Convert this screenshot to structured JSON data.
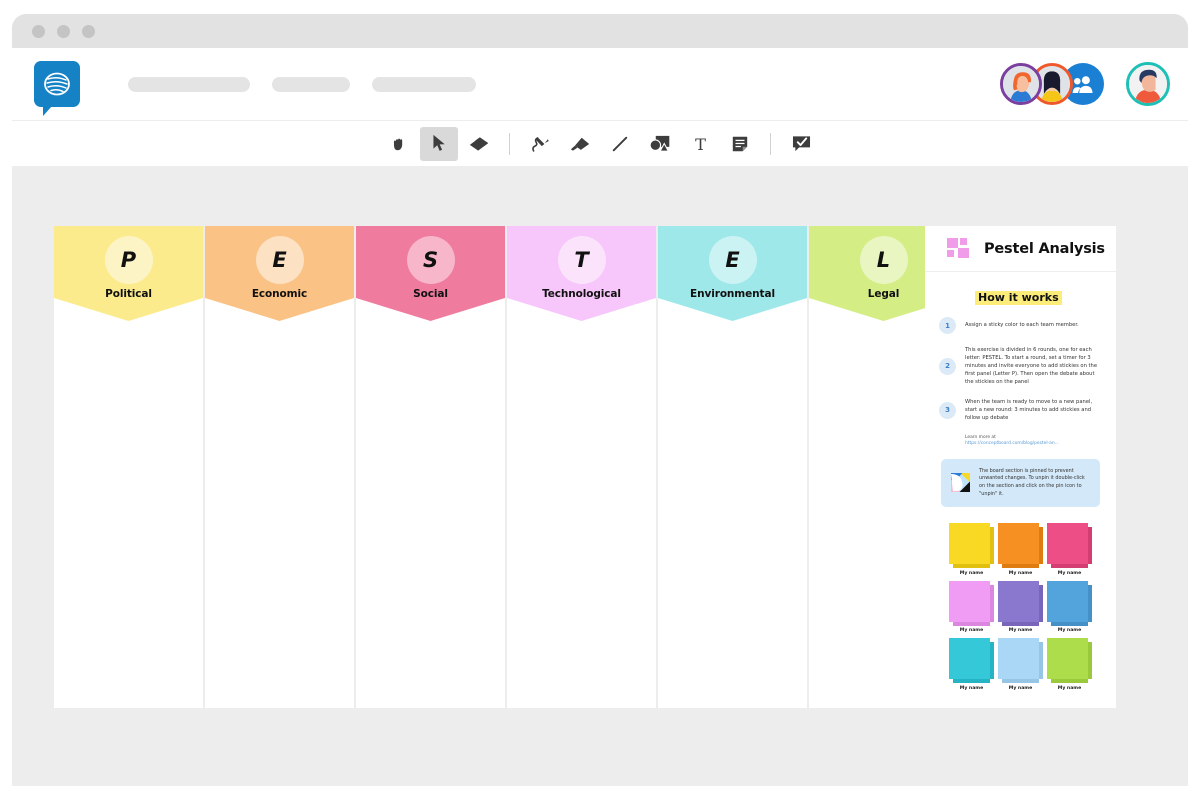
{
  "window": {
    "traffic_lights": [
      "close",
      "minimize",
      "maximize"
    ]
  },
  "header": {
    "logo_icon": "conceptboard-speech-bubble-logo",
    "nav_placeholders": [
      "",
      "",
      ""
    ],
    "collaborators": [
      {
        "name": "collaborator-1",
        "ring_color": "#7b3fa0",
        "hair": "#f0662c",
        "shirt": "#2b7bd4",
        "skin": "#f5b392"
      },
      {
        "name": "collaborator-2",
        "ring_color": "#f0582c",
        "hair": "#1a1a2e",
        "shirt": "#f5c518",
        "skin": "#f5c6a5"
      }
    ],
    "add_people": {
      "icon": "add-people-icon",
      "background": "#1b7fd4"
    },
    "current_user": {
      "ring_color": "#1dbfb6",
      "hair": "#273a63",
      "shirt": "#f05a3c",
      "skin": "#f2b79a"
    }
  },
  "toolbar": {
    "tools": [
      {
        "id": "hand",
        "icon": "hand-icon",
        "label": "Pan",
        "active": false
      },
      {
        "id": "select",
        "icon": "cursor-icon",
        "label": "Select",
        "active": true
      },
      {
        "id": "eraser",
        "icon": "eraser-icon",
        "label": "Eraser",
        "active": false
      },
      {
        "id": "pen",
        "icon": "pen-icon",
        "label": "Pen",
        "active": false
      },
      {
        "id": "marker",
        "icon": "marker-icon",
        "label": "Marker",
        "active": false
      },
      {
        "id": "line",
        "icon": "line-icon",
        "label": "Line",
        "active": false
      },
      {
        "id": "shapes",
        "icon": "shapes-icon",
        "label": "Shapes",
        "active": false
      },
      {
        "id": "text",
        "icon": "text-icon",
        "label": "Text",
        "active": false
      },
      {
        "id": "note",
        "icon": "sticky-note-icon",
        "label": "Note",
        "active": false
      },
      {
        "id": "comment",
        "icon": "comment-icon",
        "label": "Comment",
        "active": false
      }
    ]
  },
  "board": {
    "columns": [
      {
        "letter": "P",
        "label": "Political",
        "banner_color": "#fbeb8c",
        "circle_color": "#fdf4c5"
      },
      {
        "letter": "E",
        "label": "Economic",
        "banner_color": "#fac284",
        "circle_color": "#fde1c3"
      },
      {
        "letter": "S",
        "label": "Social",
        "banner_color": "#ef7b9f",
        "circle_color": "#f8b6cb"
      },
      {
        "letter": "T",
        "label": "Technological",
        "banner_color": "#f7c6fb",
        "circle_color": "#fbe3fc"
      },
      {
        "letter": "E",
        "label": "Environmental",
        "banner_color": "#9ee8ea",
        "circle_color": "#cbf3f4"
      },
      {
        "letter": "L",
        "label": "Legal",
        "banner_color": "#d4ed85",
        "circle_color": "#e9f6c2"
      }
    ]
  },
  "panel": {
    "icon": "pestel-grid-icon",
    "icon_color": "#f09ce8",
    "title": "Pestel Analysis",
    "section_heading": "How it works",
    "heading_highlight_color": "#fcec7a",
    "steps": [
      {
        "num": "1",
        "text": "Assign a sticky color to each team member."
      },
      {
        "num": "2",
        "text": "This exercise is divided in 6 rounds, one for each letter: PESTEL. To start a round, set a timer for 3 minutes and invite everyone to add stickies on the first panel (Letter P). Then open the debate about the stickies on the panel"
      },
      {
        "num": "3",
        "text": "When the team is ready to move to a new panel, start a new round: 3 minutes to add stickies and follow up debate"
      }
    ],
    "learn_more_label": "Learn more at",
    "learn_more_url": "https://conceptboard.com/blog/pestel-an...",
    "callout": {
      "icon": "pinned-section-icon",
      "text": "The board section is pinned to prevent unwanted changes. To unpin it double-click on the section and click on the pin icon to \"unpin\" it.",
      "background": "#d3e8f8"
    },
    "sticky_legend": [
      {
        "color": "#f9d923",
        "shade": "#e2c010",
        "label": "My name"
      },
      {
        "color": "#f79022",
        "shade": "#de7c12",
        "label": "My name"
      },
      {
        "color": "#ec4e85",
        "shade": "#d43d72",
        "label": "My name"
      },
      {
        "color": "#f09cf5",
        "shade": "#db87e0",
        "label": "My name"
      },
      {
        "color": "#8a77ce",
        "shade": "#7966ba",
        "label": "My name"
      },
      {
        "color": "#53a3dc",
        "shade": "#4590c7",
        "label": "My name"
      },
      {
        "color": "#35c8d8",
        "shade": "#25b4c4",
        "label": "My name"
      },
      {
        "color": "#aad7f5",
        "shade": "#96c5e6",
        "label": "My name"
      },
      {
        "color": "#aedd4b",
        "shade": "#9bc93c",
        "label": "My name"
      }
    ]
  }
}
